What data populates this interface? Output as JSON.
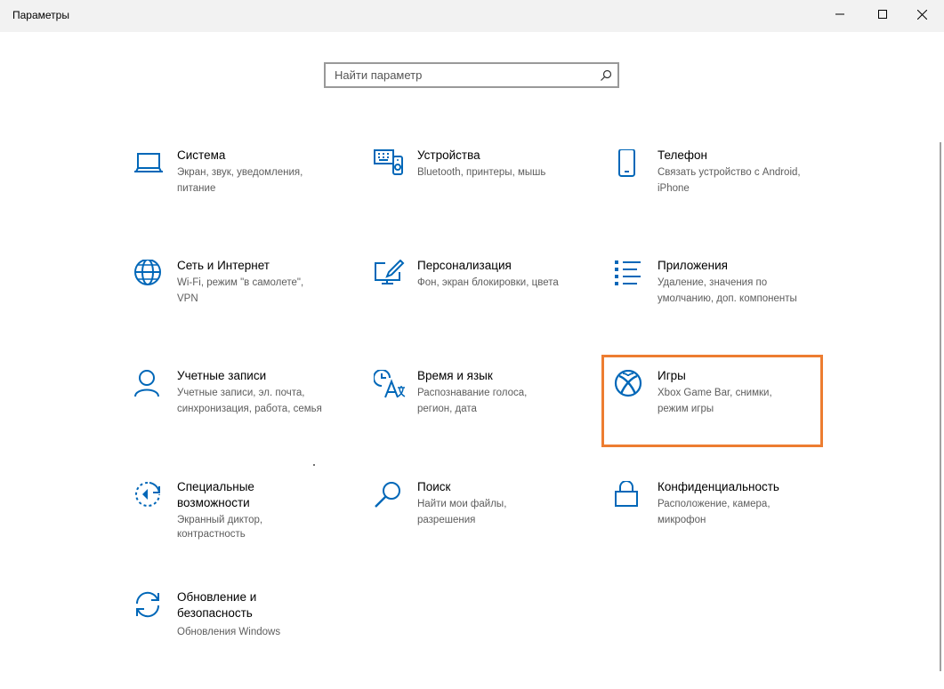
{
  "window": {
    "title": "Параметры",
    "controls": [
      "minimize",
      "maximize",
      "close"
    ]
  },
  "search": {
    "placeholder": "Найти параметр"
  },
  "colors": {
    "accent": "#0067b8",
    "highlight": "#ed7d31"
  },
  "tiles": [
    {
      "title": "Система",
      "desc": [
        "Экран, звук, уведомления,",
        "питание"
      ],
      "icon": "laptop-icon"
    },
    {
      "title": "Устройства",
      "desc": [
        "Bluetooth, принтеры, мышь"
      ],
      "icon": "devices-icon"
    },
    {
      "title": "Телефон",
      "desc": [
        "Связать устройство с Android,",
        "iPhone"
      ],
      "icon": "phone-icon"
    },
    {
      "title": "Сеть и Интернет",
      "desc": [
        "Wi-Fi, режим \"в самолете\",",
        "VPN"
      ],
      "icon": "globe-icon"
    },
    {
      "title": "Персонализация",
      "desc": [
        "Фон, экран блокировки, цвета"
      ],
      "icon": "paint-icon"
    },
    {
      "title": "Приложения",
      "desc": [
        "Удаление, значения по",
        "умолчанию, доп. компоненты"
      ],
      "icon": "apps-list-icon"
    },
    {
      "title": "Учетные записи",
      "desc": [
        "Учетные записи, эл. почта,",
        "синхронизация, работа, семья"
      ],
      "icon": "person-icon"
    },
    {
      "title": "Время и язык",
      "desc": [
        "Распознавание голоса,",
        "регион, дата"
      ],
      "icon": "time-language-icon"
    },
    {
      "title": "Игры",
      "desc": [
        "Xbox Game Bar, снимки,",
        "режим игры"
      ],
      "icon": "xbox-icon"
    },
    {
      "title": "Специальные возможности",
      "desc": [
        "Экранный диктор,",
        "контрастность"
      ],
      "icon": "accessibility-icon"
    },
    {
      "title": "Поиск",
      "desc": [
        "Найти мои файлы,",
        "разрешения"
      ],
      "icon": "search-icon"
    },
    {
      "title": "Конфиденциальность",
      "desc": [
        "Расположение, камера,",
        "микрофон"
      ],
      "icon": "lock-icon"
    },
    {
      "title": "Обновление и безопасность",
      "desc": [
        "Обновления Windows"
      ],
      "icon": "update-icon"
    }
  ]
}
